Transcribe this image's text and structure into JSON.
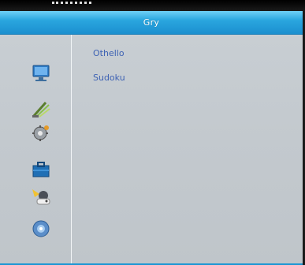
{
  "window": {
    "title": "Gry"
  },
  "sidebar": {
    "icons": [
      {
        "name": "monitor-icon"
      },
      {
        "name": "antenna-dish-icon"
      },
      {
        "name": "settings-gear-icon"
      },
      {
        "name": "toolbox-icon"
      },
      {
        "name": "games-icon"
      },
      {
        "name": "info-disc-icon"
      }
    ]
  },
  "main": {
    "items": [
      {
        "label": "Othello"
      },
      {
        "label": "Sudoku"
      }
    ]
  },
  "colors": {
    "title_bar": "#2aa6df",
    "panel_background": "#c5cbd0",
    "item_text": "#3f63b4"
  }
}
